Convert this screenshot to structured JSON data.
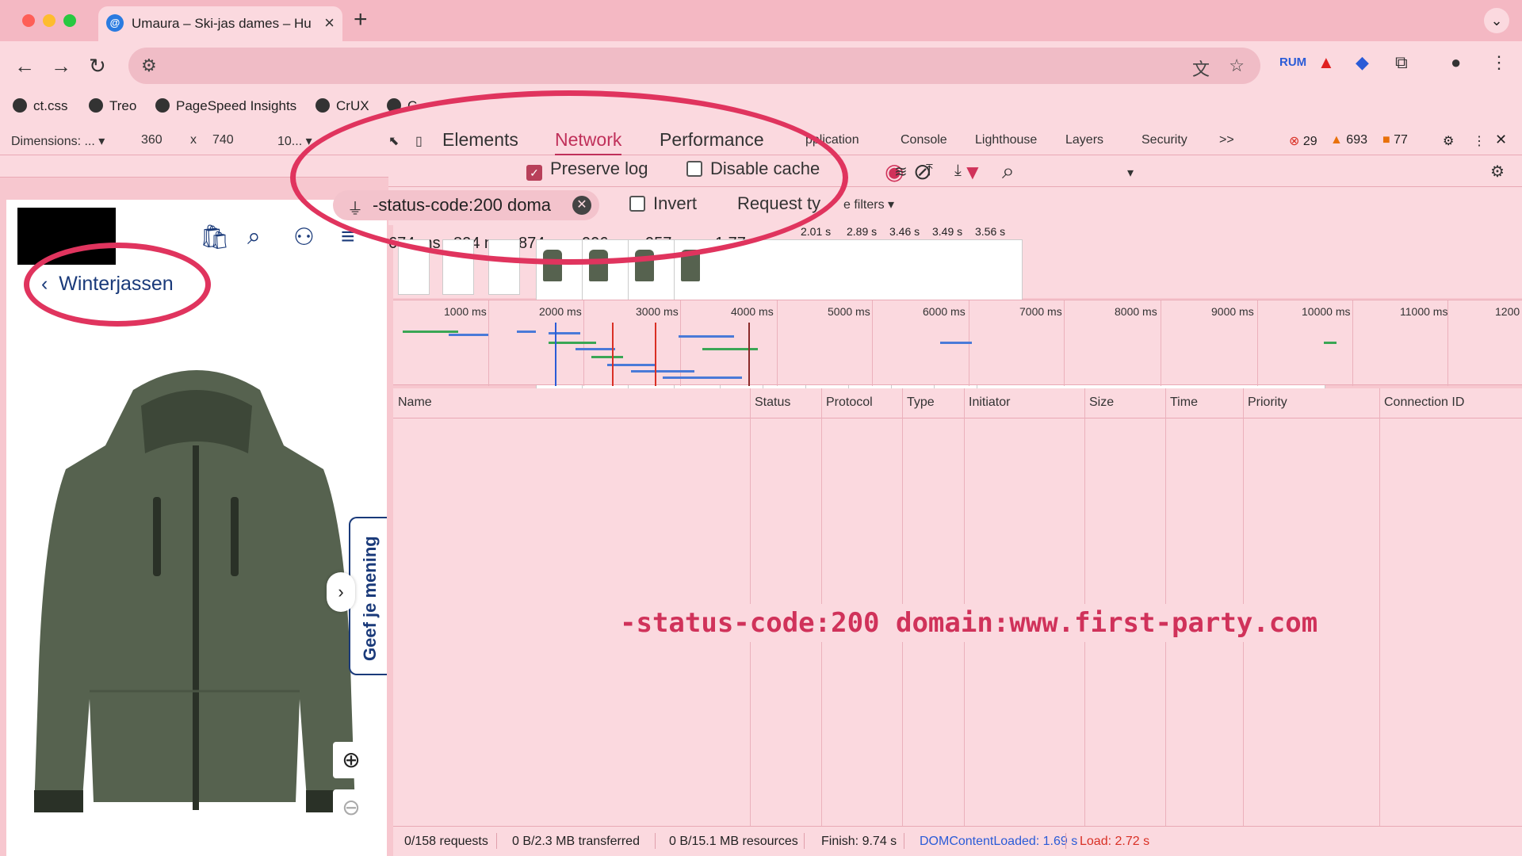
{
  "browser": {
    "tab_title": "Umaura – Ski-jas dames – Hu",
    "tab_favicon": "@",
    "url": "",
    "bookmarks": [
      "ct.css",
      "Treo",
      "PageSpeed Insights",
      "CrUX",
      "C"
    ]
  },
  "device_toolbar": {
    "dimensions_label": "Dimensions: ...",
    "width": "360",
    "times": "x",
    "height": "740",
    "zoom": "10..."
  },
  "devtools": {
    "tabs": [
      "Elements",
      "Network",
      "Performance",
      "pplication",
      "Console",
      "Lighthouse",
      "Layers",
      "Security",
      ">>"
    ],
    "active_tab": "Network",
    "errors": "29",
    "warnings": "693",
    "issues": "77",
    "colors": {
      "accent": "#c0305a",
      "error": "#d93025",
      "warning": "#e8710a"
    }
  },
  "network": {
    "preserve_log_label": "Preserve log",
    "preserve_log_checked": true,
    "disable_cache_label": "Disable cache",
    "disable_cache_checked": false,
    "filter_value": "-status-code:200 doma",
    "invert_label": "Invert",
    "request_types_label": "Request ty",
    "more_filters_label": "e filters",
    "filmstrip_times_large": [
      "674 ms",
      "824 ms",
      "874 ms",
      "906 ms",
      "957 ms",
      "1.77"
    ],
    "filmstrip_times_small": [
      "2.01 s",
      "2.89 s",
      "3.46 s",
      "3.49 s",
      "3.56 s"
    ],
    "overview_ticks": [
      "1000 ms",
      "2000 ms",
      "3000 ms",
      "4000 ms",
      "5000 ms",
      "6000 ms",
      "7000 ms",
      "8000 ms",
      "9000 ms",
      "10000 ms",
      "11000 ms",
      "1200"
    ],
    "columns": [
      "Name",
      "Status",
      "Protocol",
      "Type",
      "Initiator",
      "Size",
      "Time",
      "Priority",
      "Connection ID"
    ],
    "overlay_filter": "-status-code:200 domain:www.first-party.com",
    "status": {
      "requests": "0/158 requests",
      "transferred": "0 B/2.3 MB transferred",
      "resources": "0 B/15.1 MB resources",
      "finish": "Finish: 9.74 s",
      "dcl": "DOMContentLoaded: 1.69 s",
      "load": "Load: 2.72 s"
    }
  },
  "mobile_page": {
    "back_link": "Winterjassen",
    "feedback_tab": "Geef je mening"
  }
}
